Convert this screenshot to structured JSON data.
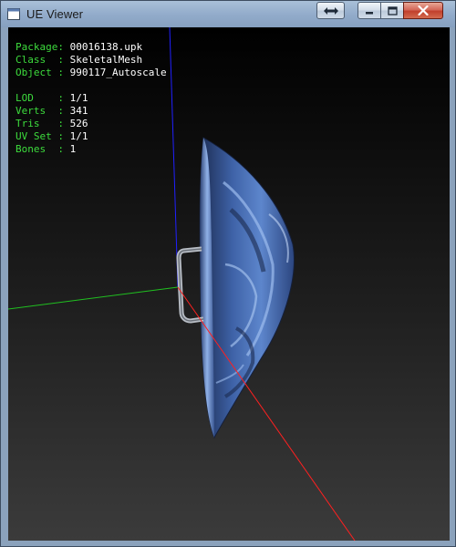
{
  "window": {
    "title": "UE Viewer"
  },
  "info": {
    "package_label": "Package: ",
    "package_value": "00016138.upk",
    "class_label": "Class  : ",
    "class_value": "SkeletalMesh",
    "object_label": "Object : ",
    "object_value": "990117_Autoscale",
    "lod_label": "LOD    : ",
    "lod_value": "1/1",
    "verts_label": "Verts  : ",
    "verts_value": "341",
    "tris_label": "Tris   : ",
    "tris_value": "526",
    "uvset_label": "UV Set : ",
    "uvset_value": "1/1",
    "bones_label": "Bones  : ",
    "bones_value": "1"
  },
  "colors": {
    "info_label": "#3ddc3d",
    "info_value": "#ffffff",
    "axis_x": "#ff2020",
    "axis_y": "#20c020",
    "axis_z": "#2020ff",
    "mesh": "#4a6fb0"
  },
  "icons": {
    "app": "app-icon",
    "restore_extra": "double-arrow-icon",
    "minimize": "minimize-icon",
    "maximize": "maximize-icon",
    "close": "close-icon"
  }
}
